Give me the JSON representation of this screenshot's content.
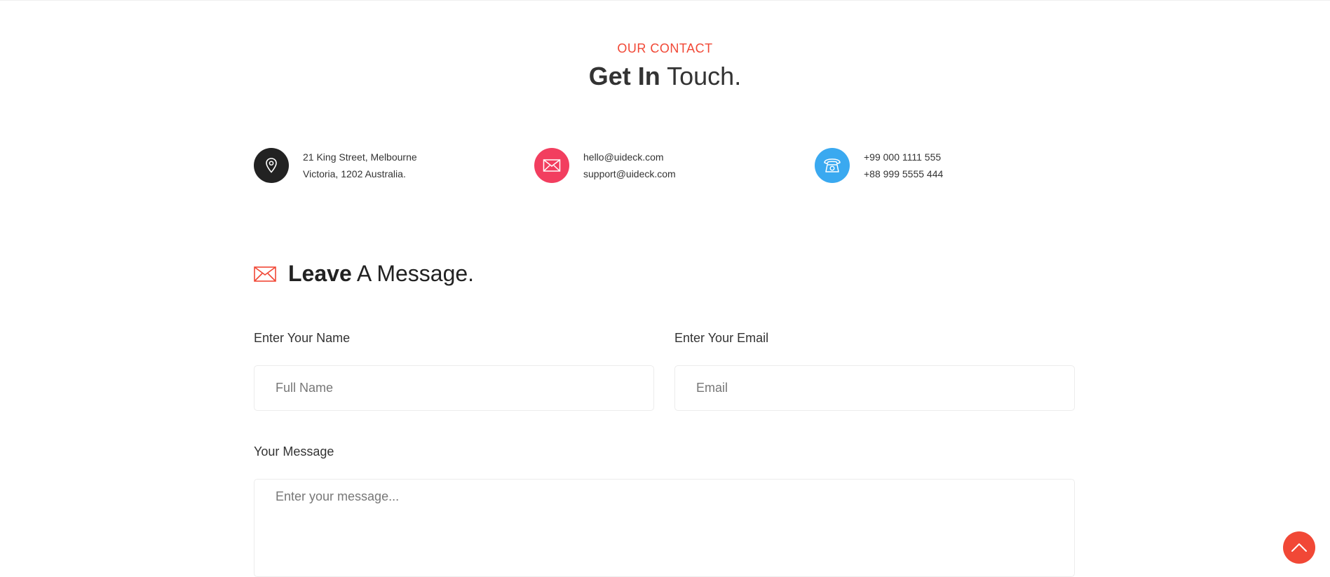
{
  "section": {
    "tag": "OUR CONTACT",
    "title_bold": "Get In",
    "title_rest": "Touch."
  },
  "contacts": [
    {
      "icon": "map-pin-icon",
      "color": "#222222",
      "lines": [
        "21 King Street, Melbourne",
        "Victoria, 1202 Australia."
      ]
    },
    {
      "icon": "envelope-icon",
      "color": "#f23e5f",
      "lines": [
        "hello@uideck.com",
        "support@uideck.com"
      ]
    },
    {
      "icon": "phone-icon",
      "color": "#3aa9f0",
      "lines": [
        "+99 000 1111 555",
        "+88 999 5555 444"
      ]
    }
  ],
  "form": {
    "heading_bold": "Leave",
    "heading_rest": "A Message.",
    "heading_icon": "envelope-icon",
    "name_label": "Enter Your Name",
    "name_placeholder": "Full Name",
    "email_label": "Enter Your Email",
    "email_placeholder": "Email",
    "message_label": "Your Message",
    "message_placeholder": "Enter your message..."
  },
  "scroll_top": {
    "icon": "chevron-up-icon",
    "color": "#f14836"
  }
}
